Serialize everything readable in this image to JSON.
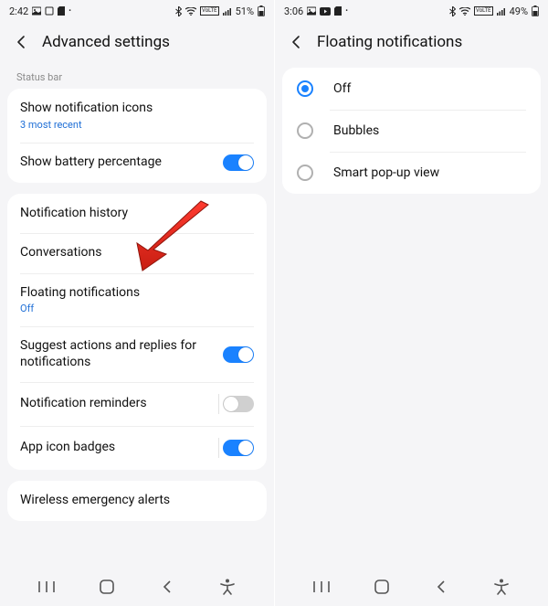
{
  "left": {
    "status": {
      "time": "2:42",
      "battery": "51%",
      "volte": "VoLTE"
    },
    "header": {
      "title": "Advanced settings"
    },
    "section_label": "Status bar",
    "rows": {
      "show_notif_icons": {
        "label": "Show notification icons",
        "sub": "3 most recent"
      },
      "show_battery_pct": {
        "label": "Show battery percentage"
      },
      "notif_history": {
        "label": "Notification history"
      },
      "conversations": {
        "label": "Conversations"
      },
      "floating": {
        "label": "Floating notifications",
        "sub": "Off"
      },
      "suggest_actions": {
        "label": "Suggest actions and replies for notifications"
      },
      "notif_reminders": {
        "label": "Notification reminders"
      },
      "app_icon_badges": {
        "label": "App icon badges"
      },
      "wireless_alerts": {
        "label": "Wireless emergency alerts"
      }
    }
  },
  "right": {
    "status": {
      "time": "3:06",
      "battery": "49%",
      "volte": "VoLTE"
    },
    "header": {
      "title": "Floating notifications"
    },
    "options": {
      "off": "Off",
      "bubbles": "Bubbles",
      "smart": "Smart pop-up view"
    }
  }
}
